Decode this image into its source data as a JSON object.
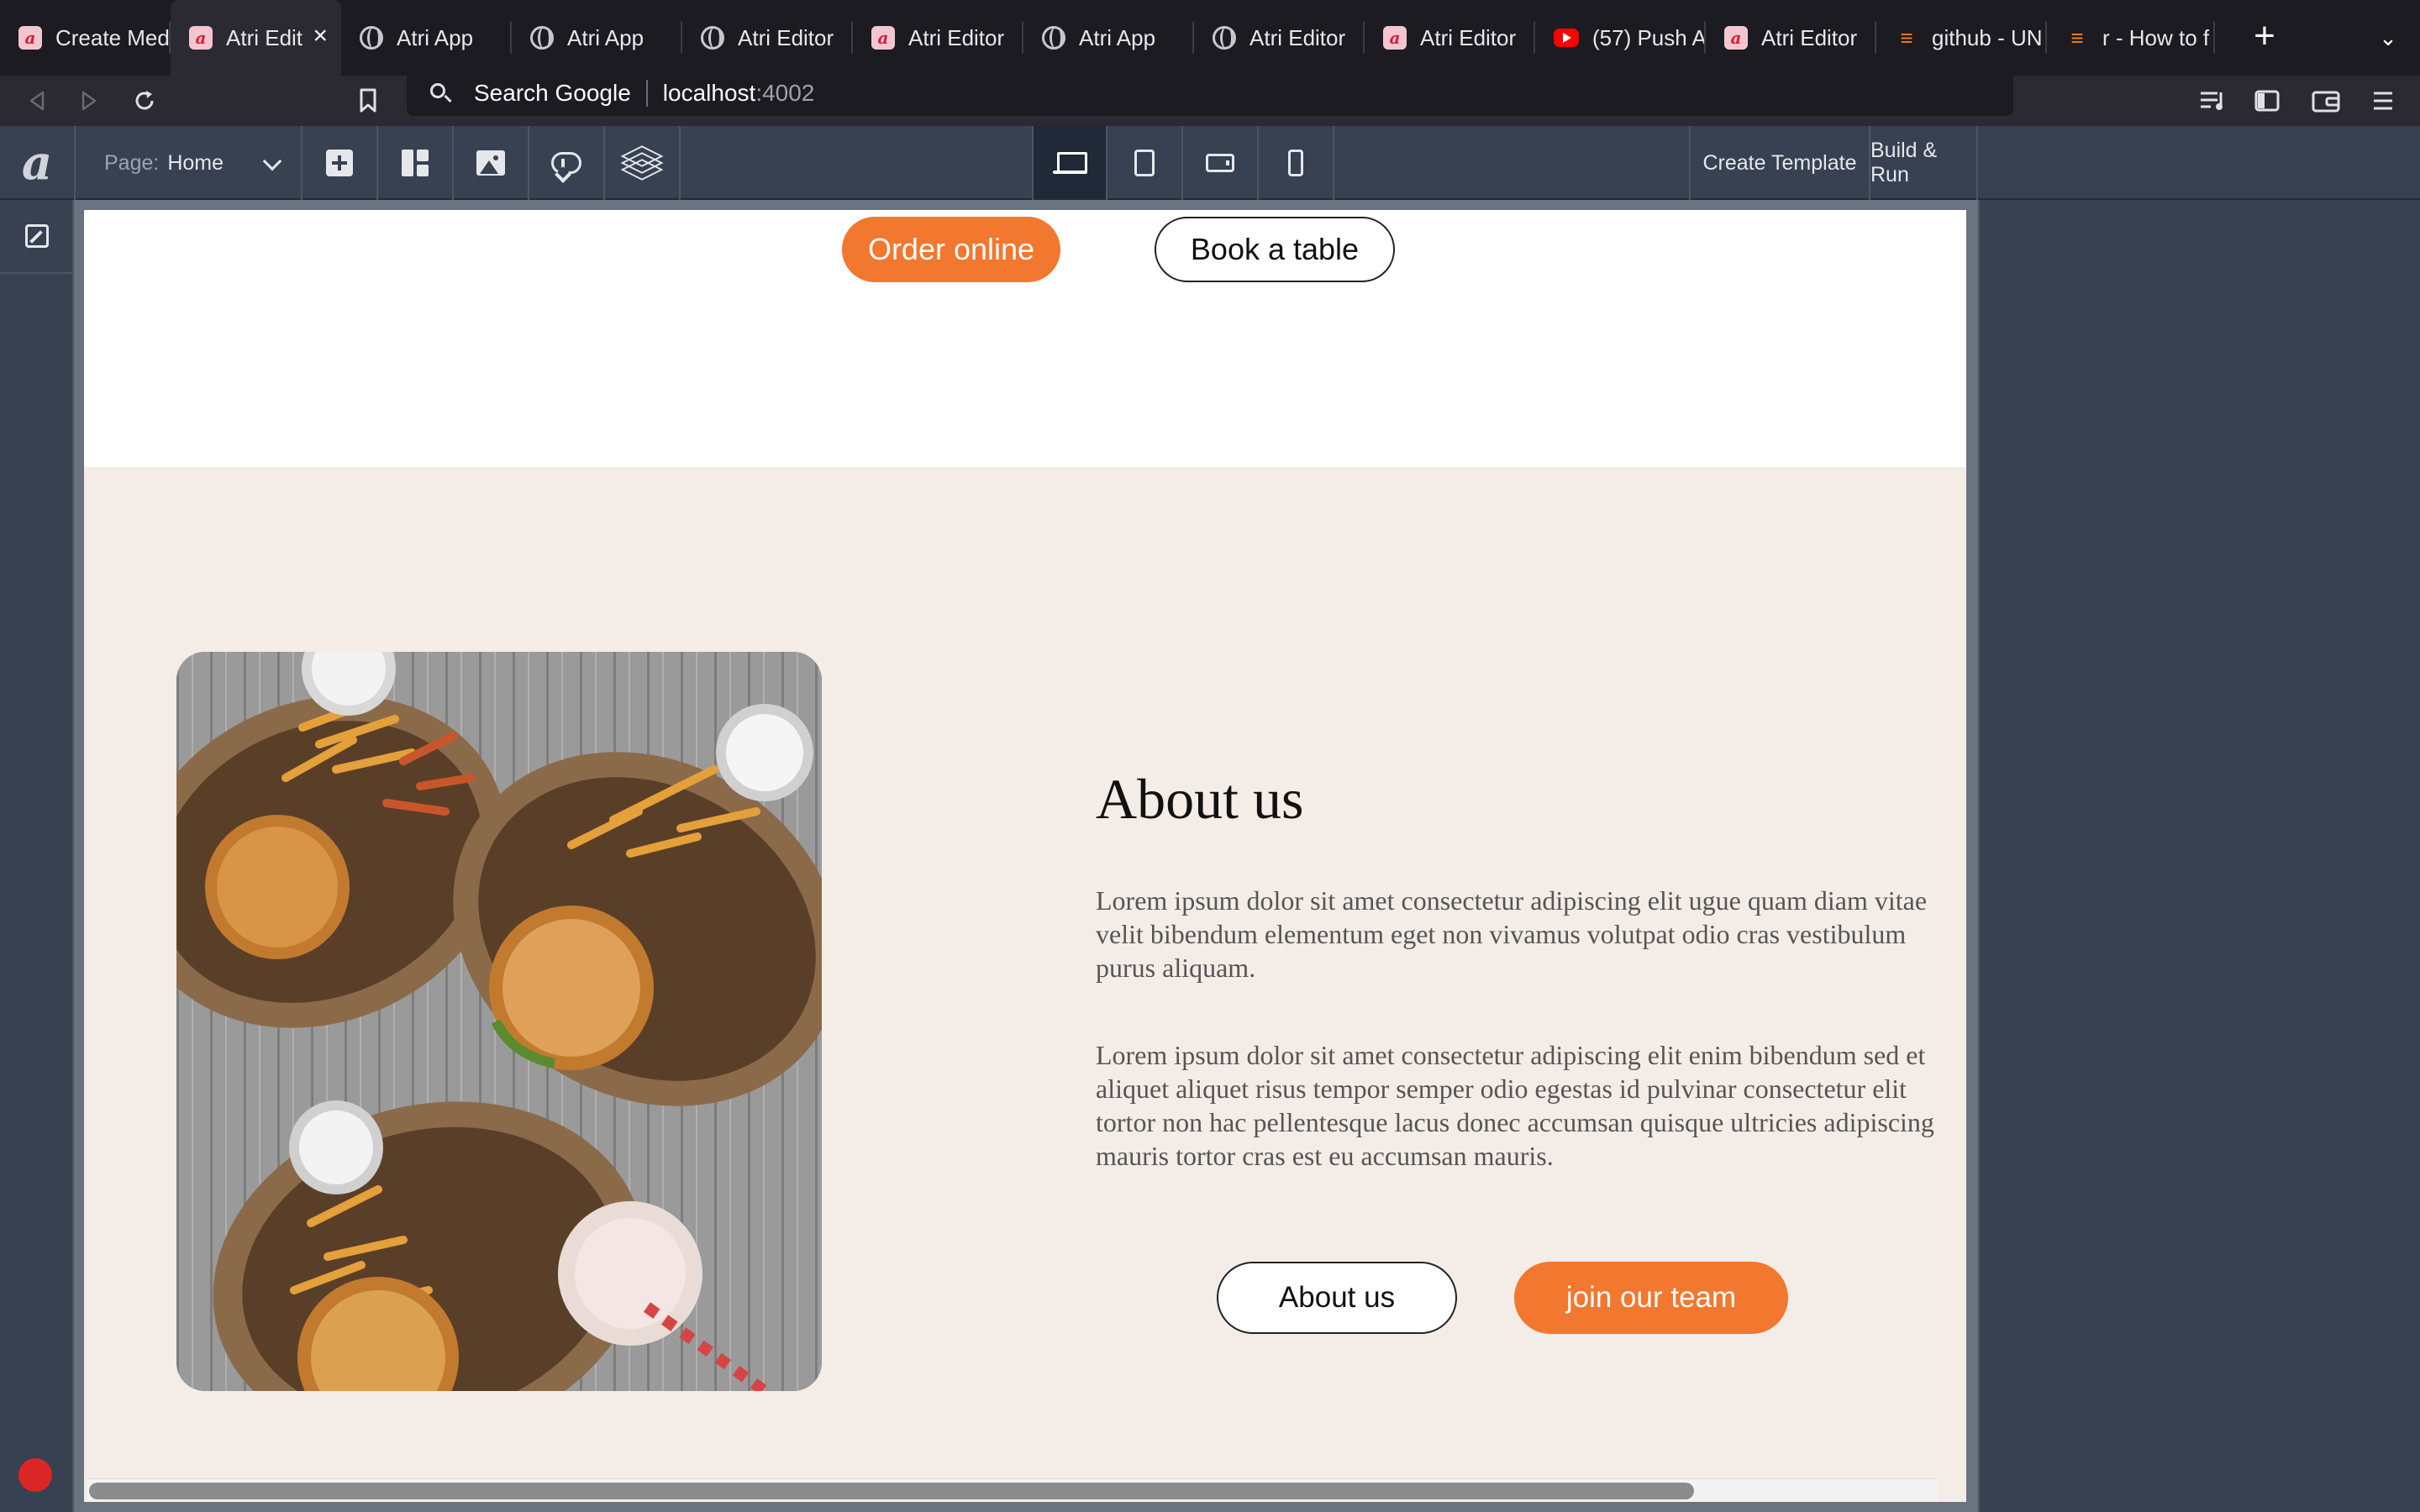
{
  "browser": {
    "tabs": [
      {
        "title": "Create Med",
        "icon": "atri-favicon-icon"
      },
      {
        "title": "Atri Edit",
        "icon": "atri-favicon-icon",
        "active": true
      },
      {
        "title": "Atri App",
        "icon": "globe-icon"
      },
      {
        "title": "Atri App",
        "icon": "globe-icon"
      },
      {
        "title": "Atri Editor",
        "icon": "globe-icon"
      },
      {
        "title": "Atri Editor",
        "icon": "atri-favicon-icon"
      },
      {
        "title": "Atri App",
        "icon": "globe-icon"
      },
      {
        "title": "Atri Editor",
        "icon": "globe-icon"
      },
      {
        "title": "Atri Editor",
        "icon": "atri-favicon-icon"
      },
      {
        "title": "(57) Push A",
        "icon": "youtube-icon"
      },
      {
        "title": "Atri Editor",
        "icon": "atri-favicon-icon"
      },
      {
        "title": "github - UN",
        "icon": "stackoverflow-icon"
      },
      {
        "title": "r - How to f",
        "icon": "stackoverflow-icon"
      }
    ],
    "new_tab_symbol": "+",
    "tab_list_symbol": "⌄",
    "url": {
      "engine_label": "Search Google",
      "host": "localhost",
      "port": ":4002"
    }
  },
  "editor": {
    "logo": "a",
    "page_label": "Page:",
    "page_value": "Home",
    "toolbar_icons": [
      "add-component-icon",
      "layout-icon",
      "image-assets-icon",
      "cloud-download-icon",
      "layers-icon"
    ],
    "devices": [
      {
        "name": "laptop-icon",
        "active": true
      },
      {
        "name": "tablet-icon",
        "active": false
      },
      {
        "name": "tablet-landscape-icon",
        "active": false
      },
      {
        "name": "phone-icon",
        "active": false
      }
    ],
    "create_template_label": "Create Template",
    "build_run_label": "Build & Run"
  },
  "page": {
    "hero_buttons": {
      "order_online": "Order online",
      "book_table": "Book a table"
    },
    "about": {
      "title": "About us",
      "paragraph1": "Lorem ipsum dolor sit amet consectetur adipiscing elit ugue quam diam vitae velit bibendum elementum eget non vivamus volutpat odio cras vestibulum purus aliquam.",
      "paragraph2": "Lorem ipsum dolor sit amet consectetur adipiscing elit enim bibendum sed et aliquet aliquet risus tempor semper odio egestas id pulvinar consectetur elit tortor non hac pellentesque lacus donec accumsan quisque ultricies adipiscing mauris tortor cras est eu accumsan mauris.",
      "about_button": "About us",
      "join_button": "join our team"
    }
  },
  "colors": {
    "accent_orange": "#f2772f",
    "section_bg": "#f4ece6",
    "editor_bg": "#374151"
  }
}
